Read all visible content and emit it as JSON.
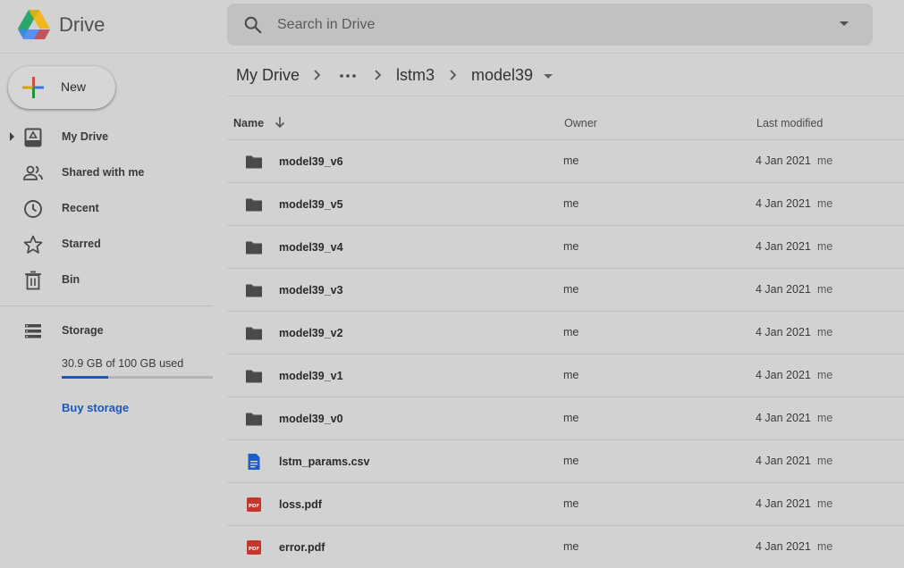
{
  "app": {
    "brand": "Drive",
    "accent_color": "#1a57b8"
  },
  "search": {
    "placeholder": "Search in Drive",
    "value": ""
  },
  "sidebar": {
    "new_label": "New",
    "items": [
      {
        "label": "My Drive",
        "icon": "my-drive-icon"
      },
      {
        "label": "Shared with me",
        "icon": "shared-icon"
      },
      {
        "label": "Recent",
        "icon": "clock-icon"
      },
      {
        "label": "Starred",
        "icon": "star-icon"
      },
      {
        "label": "Bin",
        "icon": "trash-icon"
      }
    ],
    "storage": {
      "label": "Storage",
      "usage_text": "30.9 GB of 100 GB used",
      "used_fraction": 0.309,
      "buy_label": "Buy storage"
    }
  },
  "breadcrumb": {
    "root": "My Drive",
    "more": "•••",
    "parent": "lstm3",
    "current": "model39"
  },
  "list": {
    "columns": {
      "name": "Name",
      "owner": "Owner",
      "modified": "Last modified"
    },
    "sort": "descending",
    "rows": [
      {
        "name": "model39_v6",
        "type": "folder",
        "owner": "me",
        "modified": "4 Jan 2021",
        "modified_by": "me"
      },
      {
        "name": "model39_v5",
        "type": "folder",
        "owner": "me",
        "modified": "4 Jan 2021",
        "modified_by": "me"
      },
      {
        "name": "model39_v4",
        "type": "folder",
        "owner": "me",
        "modified": "4 Jan 2021",
        "modified_by": "me"
      },
      {
        "name": "model39_v3",
        "type": "folder",
        "owner": "me",
        "modified": "4 Jan 2021",
        "modified_by": "me"
      },
      {
        "name": "model39_v2",
        "type": "folder",
        "owner": "me",
        "modified": "4 Jan 2021",
        "modified_by": "me"
      },
      {
        "name": "model39_v1",
        "type": "folder",
        "owner": "me",
        "modified": "4 Jan 2021",
        "modified_by": "me"
      },
      {
        "name": "model39_v0",
        "type": "folder",
        "owner": "me",
        "modified": "4 Jan 2021",
        "modified_by": "me"
      },
      {
        "name": "lstm_params.csv",
        "type": "doc",
        "owner": "me",
        "modified": "4 Jan 2021",
        "modified_by": "me"
      },
      {
        "name": "loss.pdf",
        "type": "pdf",
        "owner": "me",
        "modified": "4 Jan 2021",
        "modified_by": "me"
      },
      {
        "name": "error.pdf",
        "type": "pdf",
        "owner": "me",
        "modified": "4 Jan 2021",
        "modified_by": "me"
      }
    ]
  }
}
